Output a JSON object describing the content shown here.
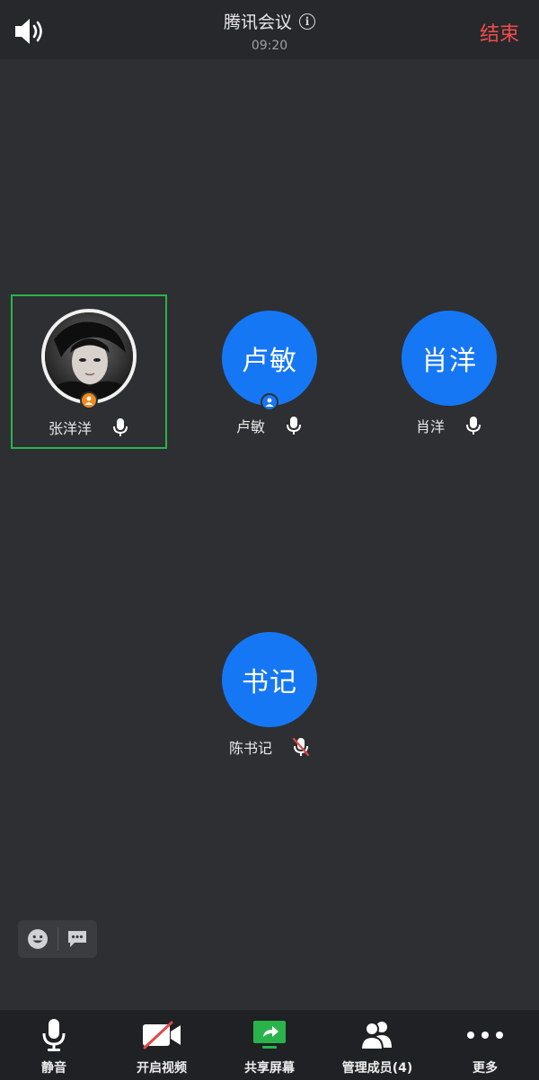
{
  "header": {
    "title": "腾讯会议",
    "timer": "09:20",
    "end_label": "结束"
  },
  "participants": [
    {
      "name": "张洋洋",
      "avatar_text": "",
      "avatar_type": "photo",
      "mic": "on",
      "role": "host",
      "active": true
    },
    {
      "name": "卢敏",
      "avatar_text": "卢敏",
      "avatar_type": "initials",
      "mic": "on",
      "role": "cohost",
      "active": false
    },
    {
      "name": "肖洋",
      "avatar_text": "肖洋",
      "avatar_type": "initials",
      "mic": "on",
      "role": "member",
      "active": false
    },
    {
      "name": "陈书记",
      "avatar_text": "书记",
      "avatar_type": "initials",
      "mic": "muted",
      "role": "member",
      "active": false
    }
  ],
  "toolbar": {
    "mute_label": "静音",
    "video_label": "开启视频",
    "share_label": "共享屏幕",
    "members_label": "管理成员(4)",
    "more_label": "更多"
  },
  "colors": {
    "avatar_blue": "#1677f5",
    "active_border": "#2bb34b",
    "end_red": "#ef4b4b",
    "host_badge": "#f08a1c",
    "share_green": "#2bb34b",
    "muted_red": "#e04848"
  },
  "icons": {
    "speaker": "speaker-icon",
    "info": "info-icon",
    "emoji": "emoji-icon",
    "chat": "chat-bubble-icon",
    "mic": "microphone-icon",
    "video_off": "video-off-icon",
    "share": "share-screen-icon",
    "members": "members-icon",
    "more": "more-dots-icon"
  }
}
